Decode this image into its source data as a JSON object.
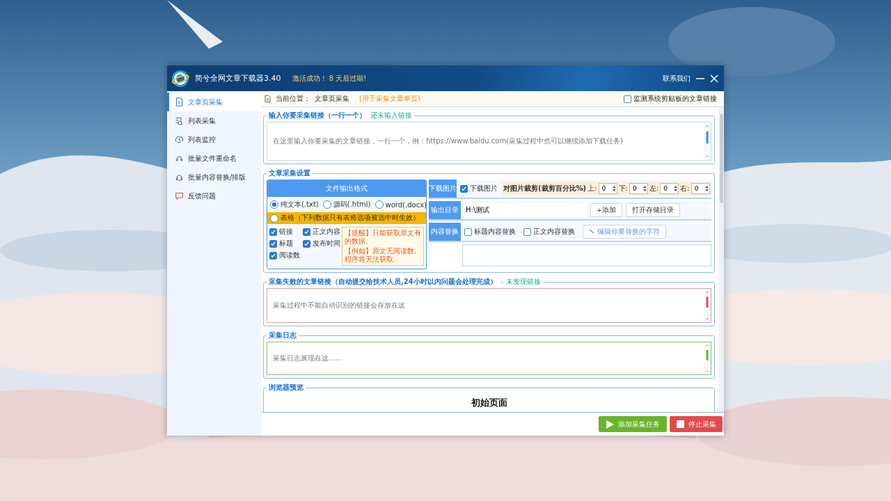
{
  "window": {
    "title": "简兮全网文章下载器3.40",
    "notice": "激活成功！ 8 天后过期!",
    "contact": "联系我们"
  },
  "sidebar": {
    "items": [
      {
        "label": "文章页采集",
        "selected": true
      },
      {
        "label": "列表采集",
        "selected": false
      },
      {
        "label": "列表监控",
        "selected": false
      },
      {
        "label": "批量文件重命名",
        "selected": false
      },
      {
        "label": "批量内容替换/排版",
        "selected": false
      },
      {
        "label": "反馈问题",
        "selected": false
      }
    ]
  },
  "breadcrumb": {
    "label": "当前位置：",
    "page": "文章页采集",
    "hint": "(用于采集文章单页)"
  },
  "monitor_clipboard": {
    "label": "监测系统剪贴板的文章链接",
    "checked": false
  },
  "link_input": {
    "legend": "输入你要采集链接（一行一个）",
    "status": "还未输入链接",
    "placeholder": "在这里输入你要采集的文章链接，一行一个，例：https://www.baidu.com(采集过程中也可以继续添加下载任务)"
  },
  "settings": {
    "legend": "文章采集设置",
    "format": {
      "title": "文件输出格式",
      "options": [
        {
          "label": "纯文本(.txt)",
          "selected": true,
          "kind": "inline"
        },
        {
          "label": "源码(.html)",
          "selected": false,
          "kind": "inline"
        },
        {
          "label": "word(.docx)",
          "selected": false,
          "kind": "inline"
        },
        {
          "label": "表格（下列数据只有表格选项被选中时生效）",
          "selected": false,
          "kind": "banner"
        }
      ],
      "fields": [
        {
          "label": "链接",
          "checked": true
        },
        {
          "label": "正文内容",
          "checked": true
        },
        {
          "label": "标题",
          "checked": true
        },
        {
          "label": "发布时间",
          "checked": true
        },
        {
          "label": "阅读数",
          "checked": true
        }
      ],
      "notes": [
        "【提醒】只能获取原文有的数据。",
        "【例如】原文无阅读数,程序将无法获取."
      ]
    },
    "download_images": {
      "label": "下载图片",
      "option": {
        "label": "下载图片",
        "checked": true
      },
      "crop_label": "对图片裁剪(裁剪百分比%)",
      "sides": [
        {
          "label": "上:",
          "value": "0"
        },
        {
          "label": "下:",
          "value": "0"
        },
        {
          "label": "左:",
          "value": "0"
        },
        {
          "label": "右:",
          "value": "0"
        }
      ]
    },
    "output_dir": {
      "label": "输出目录",
      "value": "H:\\测试",
      "buttons": [
        "+添加",
        "打开存储目录"
      ]
    },
    "replace": {
      "label": "内容替换",
      "options": [
        {
          "label": "标题内容替换",
          "checked": false
        },
        {
          "label": "正文内容替换",
          "checked": false
        }
      ],
      "edit_button": "编辑你要替换的字符"
    }
  },
  "failed_links": {
    "legend": "采集失败的文章链接（自动提交给技术人员,24小时以内问题会处理完成）",
    "status": "- 未发现链接",
    "placeholder": "采集过程中不能自动识别的链接会存放在这"
  },
  "log": {
    "legend": "采集日志",
    "placeholder": "采集日志展现在这......"
  },
  "preview": {
    "legend": "浏览器预览",
    "heading": "初始页面"
  },
  "actions": [
    {
      "label": "添加采集任务",
      "kind": "start"
    },
    {
      "label": "停止采集",
      "kind": "stop"
    }
  ]
}
